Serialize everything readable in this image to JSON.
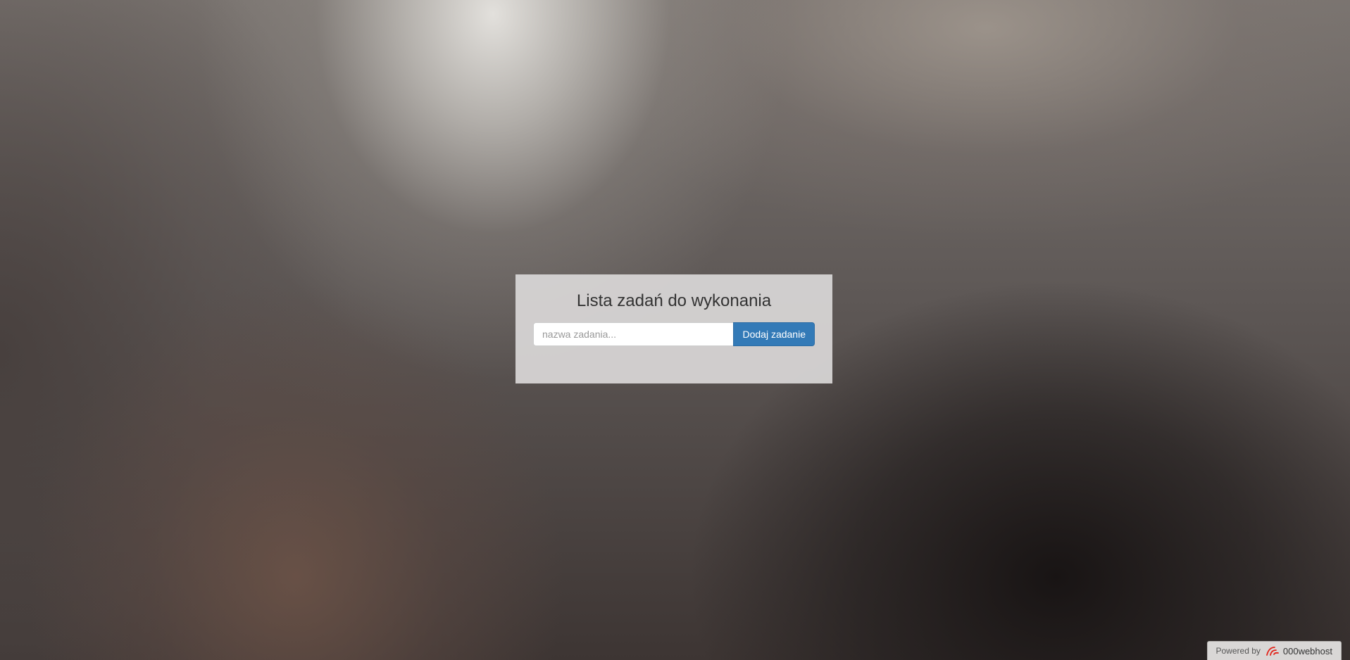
{
  "card": {
    "title": "Lista zadań do wykonania",
    "input_placeholder": "nazwa zadania...",
    "input_value": "",
    "add_button_label": "Dodaj zadanie"
  },
  "badge": {
    "powered_by": "Powered by",
    "host_name": "000webhost",
    "logo_icon": "000webhost-logo-icon"
  },
  "colors": {
    "primary_button": "#337ab7",
    "card_background": "#dad8d8",
    "logo_red": "#e2231a"
  }
}
